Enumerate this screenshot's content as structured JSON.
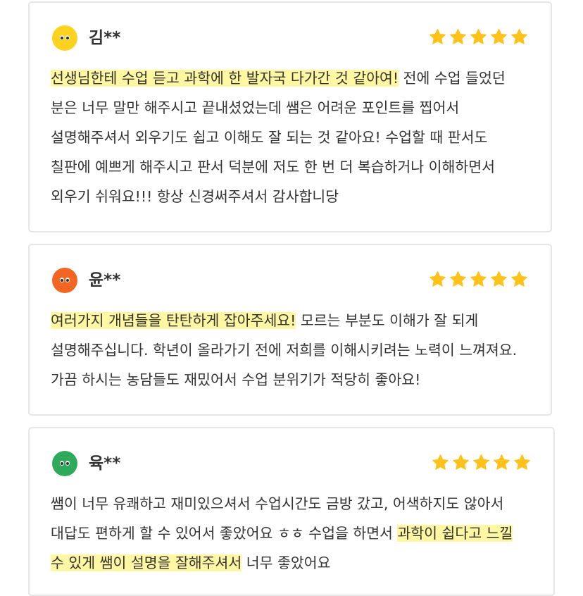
{
  "colors": {
    "star": "#ffc21a",
    "highlight": "#fff7a1",
    "card_border": "#e6e6e6"
  },
  "reviews": [
    {
      "name": "김**",
      "avatar_color": "#ffd21f",
      "rating": 5,
      "highlight": "선생님한테 수업 듣고 과학에 한 발자국 다가간 것 같아여!",
      "rest": " 전에 수업 들었던 분은 너무 말만 해주시고 끝내셨었는데 쌤은 어려운 포인트를 찝어서 설명해주셔서 외우기도 쉽고 이해도 잘 되는 것 같아요! 수업할 때 판서도 칠판에 예쁘게 해주시고 판서 덕분에 저도 한 번 더 복습하거나 이해하면서 외우기 쉬워요!!!  항상 신경써주셔서 감사합니당"
    },
    {
      "name": "윤**",
      "avatar_color": "#f26522",
      "rating": 5,
      "highlight": "여러가지 개념들을 탄탄하게 잡아주세요!",
      "rest": " 모르는 부분도 이해가 잘 되게 설명해주십니다. 학년이 올라가기 전에 저희를 이해시키려는 노력이 느껴져요. 가끔 하시는 농담들도 재밌어서 수업 분위기가 적당히 좋아요!"
    },
    {
      "name": "육**",
      "avatar_color": "#2faa5b",
      "rating": 5,
      "before": "쌤이 너무 유쾌하고 재미있으셔서 수업시간도 금방 갔고, 어색하지도 않아서 대답도 편하게 할 수 있어서 좋았어요 ㅎㅎ 수업을 하면서 ",
      "highlight": "과학이 쉽다고 느낄 수 있게 쌤이 설명을 잘해주셔서",
      "rest": " 너무 좋았어요"
    }
  ]
}
